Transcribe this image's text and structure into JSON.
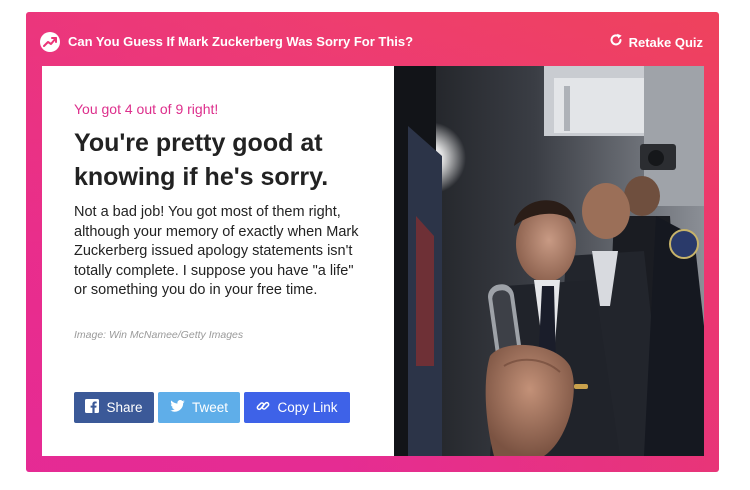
{
  "header": {
    "title": "Can You Guess If Mark Zuckerberg Was Sorry For This?",
    "retake_label": "Retake Quiz",
    "icons": {
      "brand": "trending-arrow-icon",
      "retake": "refresh-icon"
    }
  },
  "result": {
    "score": "You got 4 out of 9 right!",
    "headline": "You're pretty good at knowing if he's sorry.",
    "description": "Not a bad job! You got most of them right, although your memory of exactly when Mark Zuckerberg issued apology statements isn't totally complete. I suppose you have \"a life\" or something you do in your free time.",
    "image_credit": "Image: Win McNamee/Getty Images"
  },
  "share": {
    "facebook_label": "Share",
    "twitter_label": "Tweet",
    "copy_link_label": "Copy Link"
  },
  "colors": {
    "frame_gradient_top": "#ee3e6e",
    "frame_gradient_bottom": "#e52c93",
    "score_text": "#dd2f8c",
    "facebook": "#3b5998",
    "twitter": "#5faee9",
    "copy_link": "#3e62e8"
  }
}
